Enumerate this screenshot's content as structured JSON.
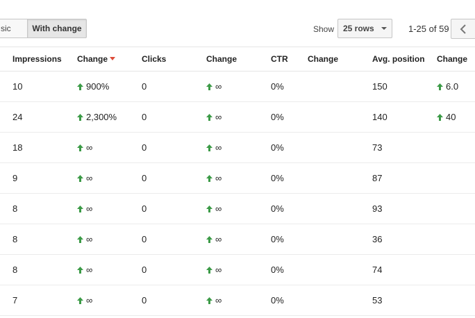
{
  "toolbar": {
    "basic_label": "sic",
    "with_change_label": "With change",
    "show_label": "Show",
    "rows_select_value": "25 rows",
    "range_text": "1-25 of 59"
  },
  "colors": {
    "positive": "#3b9a46",
    "sorted": "#dd4b39"
  },
  "table": {
    "headers": [
      "Impressions",
      "Change",
      "Clicks",
      "Change",
      "CTR",
      "Change",
      "Avg. position",
      "Change"
    ],
    "sorted_column": 1,
    "rows": [
      {
        "impressions": "10",
        "impr_change": "900%",
        "clicks": "0",
        "clicks_change": "∞",
        "ctr": "0%",
        "ctr_change": "",
        "avg_position": "150",
        "pos_change": "6.0"
      },
      {
        "impressions": "24",
        "impr_change": "2,300%",
        "clicks": "0",
        "clicks_change": "∞",
        "ctr": "0%",
        "ctr_change": "",
        "avg_position": "140",
        "pos_change": "40"
      },
      {
        "impressions": "18",
        "impr_change": "∞",
        "clicks": "0",
        "clicks_change": "∞",
        "ctr": "0%",
        "ctr_change": "",
        "avg_position": "73",
        "pos_change": ""
      },
      {
        "impressions": "9",
        "impr_change": "∞",
        "clicks": "0",
        "clicks_change": "∞",
        "ctr": "0%",
        "ctr_change": "",
        "avg_position": "87",
        "pos_change": ""
      },
      {
        "impressions": "8",
        "impr_change": "∞",
        "clicks": "0",
        "clicks_change": "∞",
        "ctr": "0%",
        "ctr_change": "",
        "avg_position": "93",
        "pos_change": ""
      },
      {
        "impressions": "8",
        "impr_change": "∞",
        "clicks": "0",
        "clicks_change": "∞",
        "ctr": "0%",
        "ctr_change": "",
        "avg_position": "36",
        "pos_change": ""
      },
      {
        "impressions": "8",
        "impr_change": "∞",
        "clicks": "0",
        "clicks_change": "∞",
        "ctr": "0%",
        "ctr_change": "",
        "avg_position": "74",
        "pos_change": ""
      },
      {
        "impressions": "7",
        "impr_change": "∞",
        "clicks": "0",
        "clicks_change": "∞",
        "ctr": "0%",
        "ctr_change": "",
        "avg_position": "53",
        "pos_change": ""
      }
    ]
  }
}
